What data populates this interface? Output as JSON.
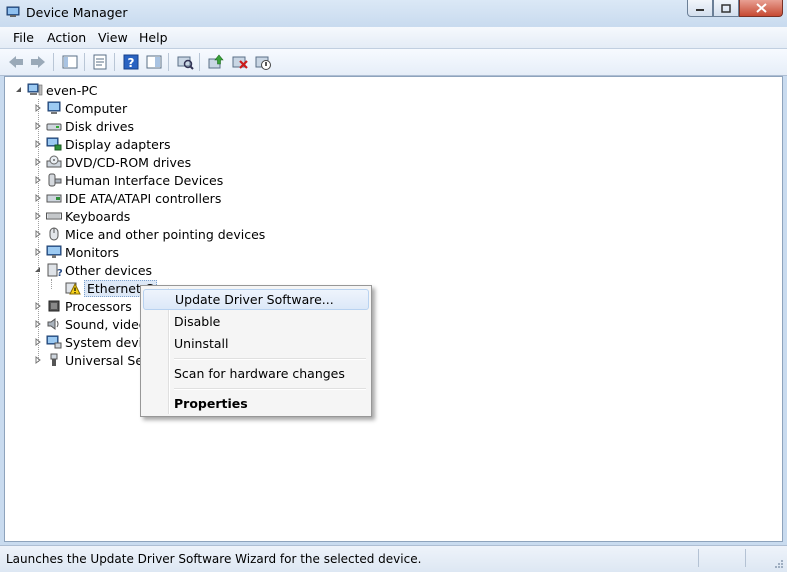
{
  "window": {
    "title": "Device Manager"
  },
  "menu": [
    "File",
    "Action",
    "View",
    "Help"
  ],
  "toolbar": {
    "buttons": [
      "back-icon",
      "forward-icon",
      "show-hide-console-tree-icon",
      "properties-icon",
      "help-icon",
      "show-action-pane-icon",
      "scan-hardware-icon",
      "update-driver-icon",
      "uninstall-icon",
      "disable-icon"
    ]
  },
  "tree": {
    "root": "even-PC",
    "items": [
      "Computer",
      "Disk drives",
      "Display adapters",
      "DVD/CD-ROM drives",
      "Human Interface Devices",
      "IDE ATA/ATAPI controllers",
      "Keyboards",
      "Mice and other pointing devices",
      "Monitors",
      "Other devices",
      "Processors",
      "Sound, video",
      "System device",
      "Universal Seria"
    ],
    "child": "Ethernet C"
  },
  "context_menu": {
    "items": [
      "Update Driver Software...",
      "Disable",
      "Uninstall",
      "Scan for hardware changes",
      "Properties"
    ]
  },
  "status": {
    "text": "Launches the Update Driver Software Wizard for the selected device."
  }
}
